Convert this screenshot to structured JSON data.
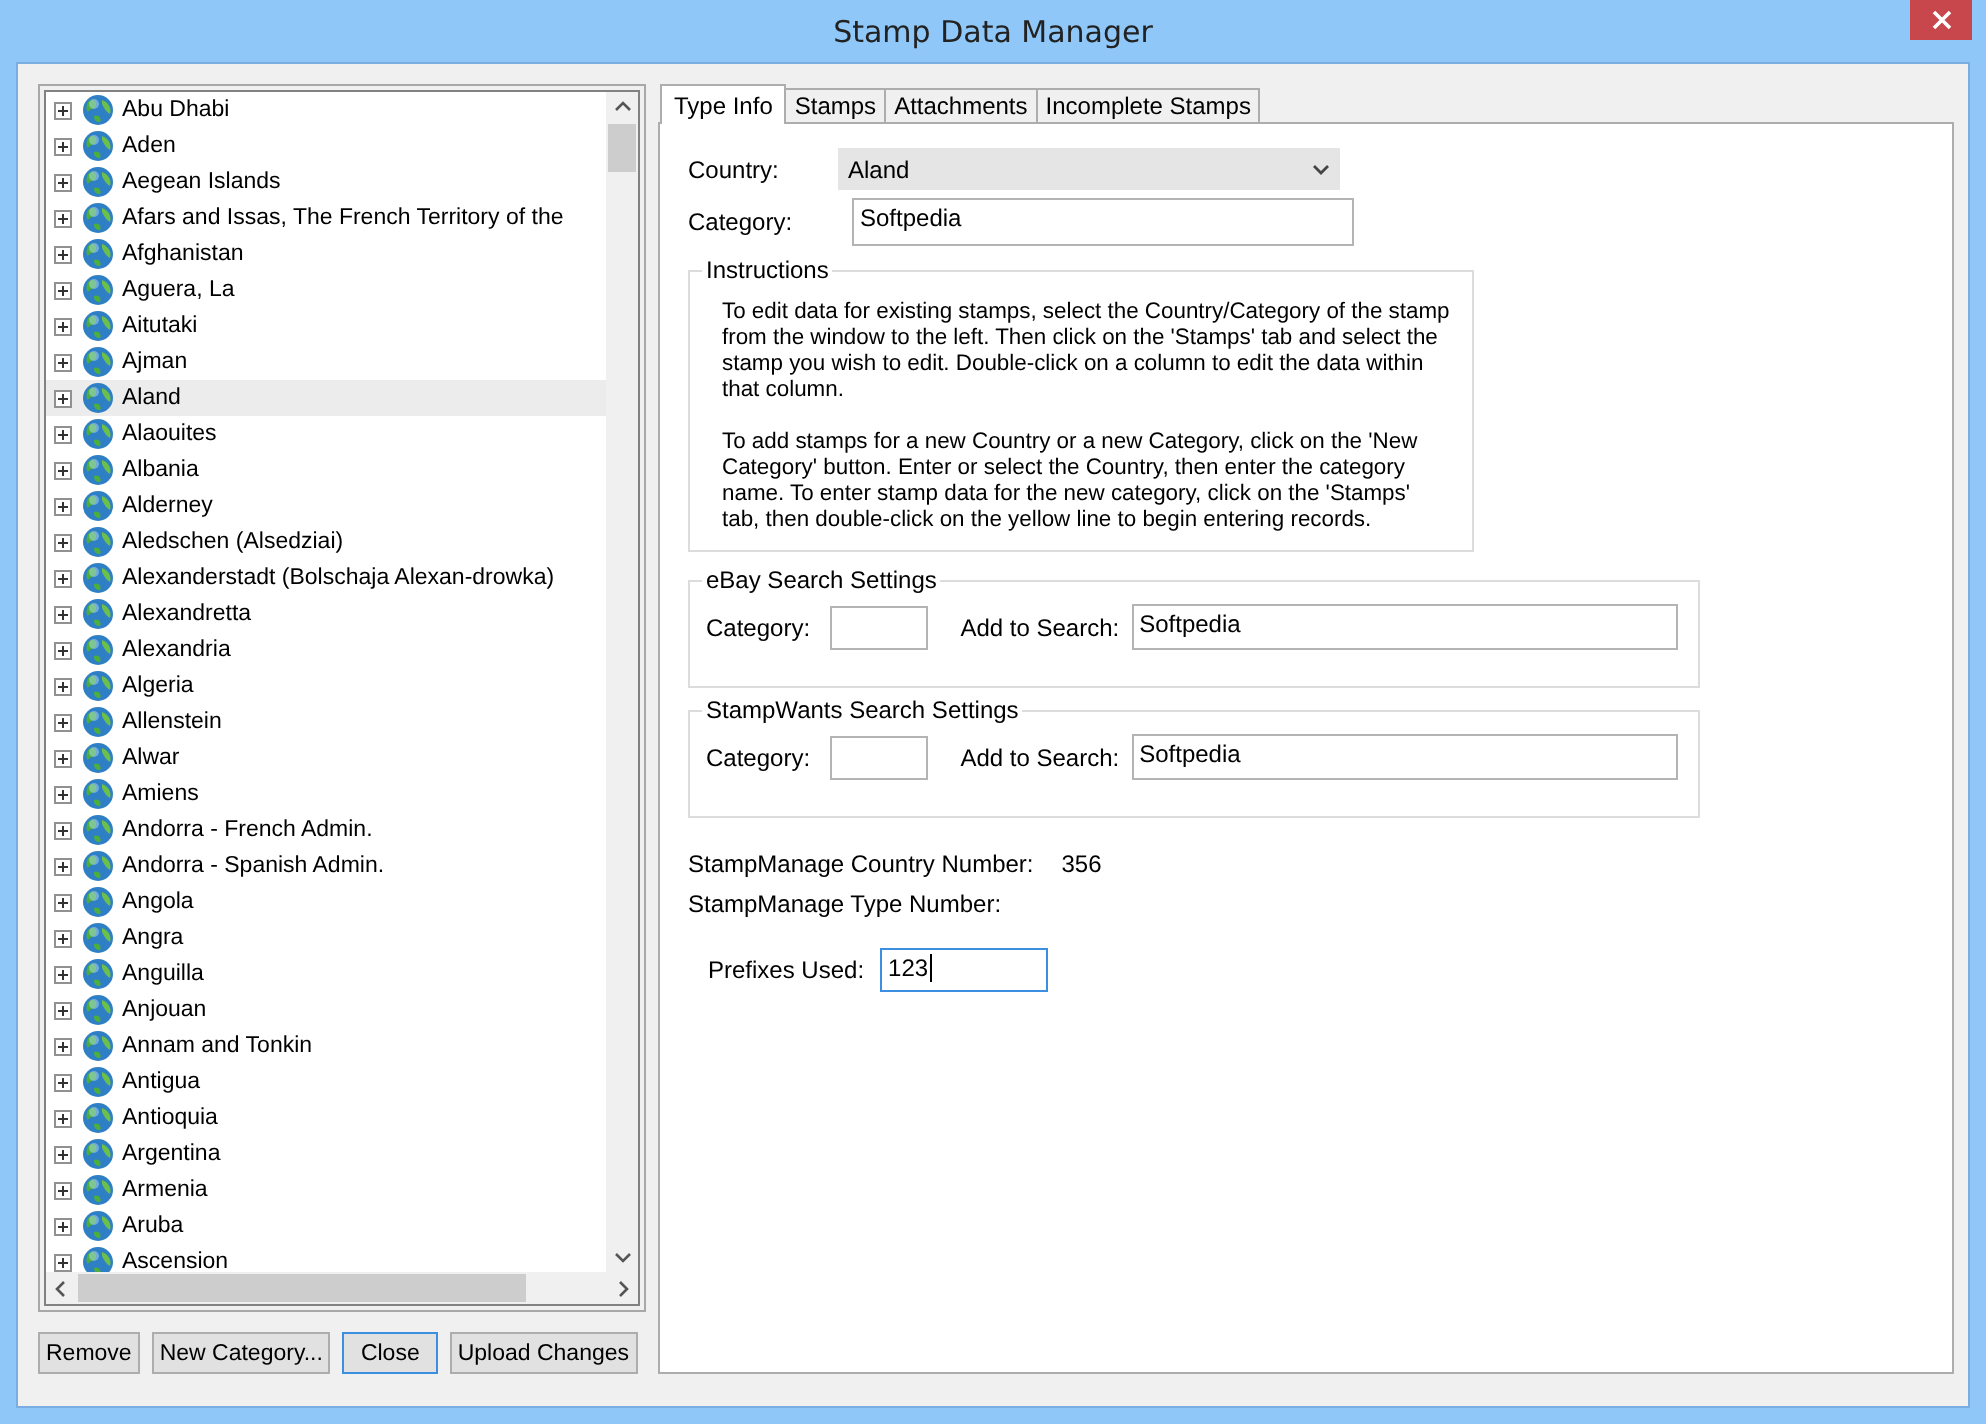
{
  "window": {
    "title": "Stamp Data Manager"
  },
  "tree": {
    "items": [
      {
        "label": "Abu Dhabi",
        "expanded": false,
        "selected": false
      },
      {
        "label": "Aden",
        "expanded": false,
        "selected": false
      },
      {
        "label": "Aegean Islands",
        "expanded": false,
        "selected": false
      },
      {
        "label": "Afars and Issas, The French Territory of the",
        "expanded": false,
        "selected": false
      },
      {
        "label": "Afghanistan",
        "expanded": false,
        "selected": false
      },
      {
        "label": "Aguera, La",
        "expanded": false,
        "selected": false
      },
      {
        "label": "Aitutaki",
        "expanded": false,
        "selected": false
      },
      {
        "label": "Ajman",
        "expanded": false,
        "selected": false
      },
      {
        "label": "Aland",
        "expanded": false,
        "selected": true
      },
      {
        "label": "Alaouites",
        "expanded": false,
        "selected": false
      },
      {
        "label": "Albania",
        "expanded": false,
        "selected": false
      },
      {
        "label": "Alderney",
        "expanded": false,
        "selected": false
      },
      {
        "label": "Aledschen (Alsedziai)",
        "expanded": false,
        "selected": false
      },
      {
        "label": "Alexanderstadt (Bolschaja Alexan-drowka)",
        "expanded": false,
        "selected": false
      },
      {
        "label": "Alexandretta",
        "expanded": false,
        "selected": false
      },
      {
        "label": "Alexandria",
        "expanded": false,
        "selected": false
      },
      {
        "label": "Algeria",
        "expanded": false,
        "selected": false
      },
      {
        "label": "Allenstein",
        "expanded": false,
        "selected": false
      },
      {
        "label": "Alwar",
        "expanded": false,
        "selected": false
      },
      {
        "label": "Amiens",
        "expanded": false,
        "selected": false
      },
      {
        "label": "Andorra - French Admin.",
        "expanded": false,
        "selected": false
      },
      {
        "label": "Andorra - Spanish Admin.",
        "expanded": false,
        "selected": false
      },
      {
        "label": "Angola",
        "expanded": false,
        "selected": false
      },
      {
        "label": "Angra",
        "expanded": false,
        "selected": false
      },
      {
        "label": "Anguilla",
        "expanded": false,
        "selected": false
      },
      {
        "label": "Anjouan",
        "expanded": false,
        "selected": false
      },
      {
        "label": "Annam and Tonkin",
        "expanded": false,
        "selected": false
      },
      {
        "label": "Antigua",
        "expanded": false,
        "selected": false
      },
      {
        "label": "Antioquia",
        "expanded": false,
        "selected": false
      },
      {
        "label": "Argentina",
        "expanded": false,
        "selected": false
      },
      {
        "label": "Armenia",
        "expanded": false,
        "selected": false
      },
      {
        "label": "Aruba",
        "expanded": false,
        "selected": false
      },
      {
        "label": "Ascension",
        "expanded": false,
        "selected": false
      }
    ]
  },
  "buttons": [
    {
      "label": "Remove",
      "focused": false
    },
    {
      "label": "New Category...",
      "focused": false
    },
    {
      "label": "Close",
      "focused": true
    },
    {
      "label": "Upload Changes",
      "focused": false
    }
  ],
  "tabs": [
    {
      "label": "Type Info",
      "selected": true
    },
    {
      "label": "Stamps",
      "selected": false
    },
    {
      "label": "Attachments",
      "selected": false
    },
    {
      "label": "Incomplete Stamps",
      "selected": false
    }
  ],
  "type_info": {
    "country": {
      "label": "Country:",
      "value": "Aland"
    },
    "category": {
      "label": "Category:",
      "value": "Softpedia"
    },
    "instructions": {
      "title": "Instructions",
      "paragraphs": [
        "To edit data for existing stamps, select the Country/Category of the stamp from the window to the left.  Then click on the 'Stamps' tab and select the stamp you wish to edit.  Double-click on a column to edit the data within that column.",
        "To add stamps for a new Country or a new Category, click on the 'New Category' button.  Enter or select the Country, then enter the category name.  To enter stamp data for the new category, click on the 'Stamps' tab, then double-click on the yellow line to begin entering records."
      ]
    },
    "search_groups": [
      {
        "title": "eBay Search Settings",
        "category_label": "Category:",
        "add_label": "Add to Search:",
        "add_value": "Softpedia"
      },
      {
        "title": "StampWants Search Settings",
        "category_label": "Category:",
        "add_label": "Add to Search:",
        "add_value": "Softpedia"
      }
    ],
    "country_number": {
      "label": "StampManage Country Number:",
      "value": "356"
    },
    "type_number": {
      "label": "StampManage Type Number:"
    },
    "prefixes": {
      "label": "Prefixes Used:",
      "value": "123",
      "focused": true
    }
  }
}
